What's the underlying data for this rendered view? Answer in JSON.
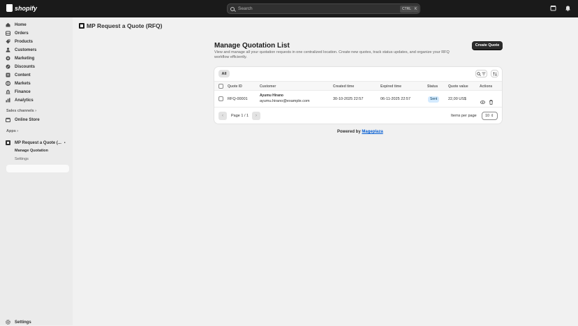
{
  "topbar": {
    "logo_text": "shopify",
    "search_placeholder": "Search",
    "shortcut_ctrl": "CTRL",
    "shortcut_key": "K"
  },
  "sidebar": {
    "items": [
      {
        "label": "Home",
        "icon": "home-icon"
      },
      {
        "label": "Orders",
        "icon": "orders-icon"
      },
      {
        "label": "Products",
        "icon": "products-icon"
      },
      {
        "label": "Customers",
        "icon": "customers-icon"
      },
      {
        "label": "Marketing",
        "icon": "marketing-icon"
      },
      {
        "label": "Discounts",
        "icon": "discounts-icon"
      },
      {
        "label": "Content",
        "icon": "content-icon"
      },
      {
        "label": "Markets",
        "icon": "markets-icon"
      },
      {
        "label": "Finance",
        "icon": "finance-icon"
      },
      {
        "label": "Analytics",
        "icon": "analytics-icon"
      }
    ],
    "sales_channels_label": "Sales channels",
    "online_store": "Online Store",
    "apps_label": "Apps",
    "app_name": "MP Request a Quote (...",
    "app_sub_active": "Manage Quotation",
    "app_sub_settings": "Settings",
    "settings": "Settings"
  },
  "main": {
    "app_title": "MP Request a Quote (RFQ)",
    "page_title": "Manage Quotation List",
    "page_desc": "View and manage all your quotation requests in one centralized location. Create new quotes, track status updates, and organize your RFQ workflow efficiently.",
    "create_button": "Create Quote",
    "tab_all": "All",
    "columns": [
      "Quote ID",
      "Customer",
      "Created time",
      "Expired time",
      "Status",
      "Quote value",
      "Actions"
    ],
    "rows": [
      {
        "quote_id": "RFQ-00001",
        "customer_name": "Ayumu Hirano",
        "customer_email": "ayumu.hirano@example.com",
        "created": "30-10-2025 22:57",
        "expired": "06-11-2025 22:57",
        "status": "Sent",
        "value": "22,00 US$"
      }
    ],
    "pagination_label": "Page 1 / 1",
    "items_per_page_label": "Items per page",
    "items_per_page_value": "10",
    "powered_by": "Powered by",
    "powered_by_link": "Mageplaza"
  },
  "colors": {
    "topbar": "#1a1a1a",
    "sidebar": "#ebebeb",
    "primary_button": "#2b2b2b",
    "status_badge_bg": "#d5ebff",
    "link": "#005bd3"
  }
}
